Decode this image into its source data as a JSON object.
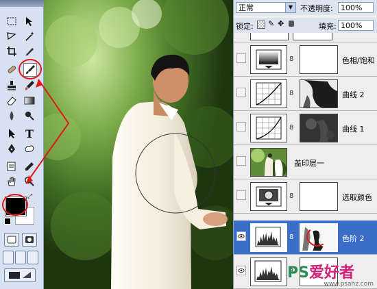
{
  "options": {
    "blend_mode": "正常",
    "opacity_label": "不透明度:",
    "opacity_value": "100%",
    "lock_label": "锁定:",
    "fill_label": "填充:",
    "fill_value": "100%"
  },
  "layers": [
    {
      "name": "色相/饱和",
      "type": "adjustment",
      "visible": false,
      "selected": false
    },
    {
      "name": "曲线 2",
      "type": "curves",
      "visible": false,
      "selected": false
    },
    {
      "name": "曲线 1",
      "type": "curves",
      "visible": false,
      "selected": false
    },
    {
      "name": "盖印层一",
      "type": "pixel",
      "visible": false,
      "selected": false
    },
    {
      "name": "选取颜色",
      "type": "adjustment",
      "visible": false,
      "selected": false
    },
    {
      "name": "色阶 2",
      "type": "levels",
      "visible": true,
      "selected": true
    },
    {
      "name": "",
      "type": "levels",
      "visible": true,
      "selected": false
    }
  ],
  "watermark": {
    "brand_ps": "PS",
    "brand_rest": "爱好者",
    "url": "www.psahz.com"
  },
  "colors": {
    "foreground": "#000000",
    "background": "#ffffff",
    "selection": "#3a6ec9",
    "annotation": "#e01818"
  },
  "tools": [
    "marquee-icon",
    "move-icon",
    "lasso-icon",
    "magic-wand-icon",
    "crop-icon",
    "slice-icon",
    "healing-icon",
    "brush-icon",
    "stamp-icon",
    "history-brush-icon",
    "eraser-icon",
    "gradient-icon",
    "blur-icon",
    "dodge-icon",
    "path-select-icon",
    "type-icon",
    "pen-icon",
    "shape-icon",
    "notes-icon",
    "eyedropper-icon",
    "hand-icon",
    "zoom-icon"
  ]
}
